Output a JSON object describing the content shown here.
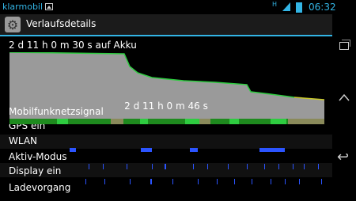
{
  "statusbar": {
    "carrier": "klarmobil",
    "network_type": "H",
    "clock": "06:32",
    "accent_color": "#33b5e5"
  },
  "actionbar": {
    "title": "Verlaufsdetails",
    "icon": "settings-gear-icon"
  },
  "history": {
    "battery_label": "2 d 11 h 0 m 30 s auf Akku",
    "duration_label": "2 d 11 h 0 m 46 s",
    "rows": [
      {
        "label": "Mobilfunknetzsignal"
      },
      {
        "label": "GPS ein"
      },
      {
        "label": "WLAN"
      },
      {
        "label": "Aktiv-Modus"
      },
      {
        "label": "Display ein"
      },
      {
        "label": "Ladevorgang"
      }
    ]
  },
  "colors": {
    "graph_fill": "#9a9a9a",
    "graph_line": "#2ecc40",
    "graph_line_low": "#c8c828",
    "wifi_bar": "#2b54ff",
    "signal_good": "#1e8a1e",
    "signal_bright": "#2ecc40",
    "signal_weak": "#8a8a5a"
  },
  "navbar": {
    "recent": "recent-apps-icon",
    "home": "home-icon",
    "back": "back-icon"
  }
}
